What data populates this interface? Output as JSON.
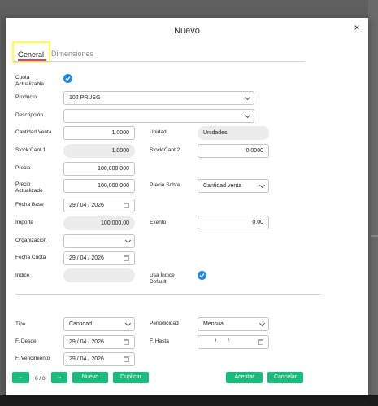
{
  "dialog": {
    "title": "Nuevo",
    "close_icon": "×"
  },
  "tabs": [
    {
      "label": "General",
      "active": true
    },
    {
      "label": "Dimensiones",
      "active": false
    }
  ],
  "form": {
    "cuota_actualizable": {
      "label": "Cuota Actualizable",
      "checked": true
    },
    "producto": {
      "label": "Producto",
      "value": "102 PRUSG"
    },
    "descripcion": {
      "label": "Descripción",
      "value": ""
    },
    "cantidad_venta": {
      "label": "Cantidad Venta",
      "value": "1.0000"
    },
    "unidad": {
      "label": "Unidad",
      "value": "Unidades"
    },
    "stock_cant1": {
      "label": "Stock:Cant.1",
      "value": "1.0000"
    },
    "stock_cant2": {
      "label": "Stock:Cant.2",
      "value": "0.0000"
    },
    "precio": {
      "label": "Precio",
      "value": "100,000.000"
    },
    "precio_actualizado": {
      "label": "Precio Actualizado",
      "value": "100,000.000"
    },
    "precio_sobre": {
      "label": "Precio Sobre",
      "value": "Cantidad venta"
    },
    "fecha_base": {
      "label": "Fecha Base",
      "day": "29",
      "month": "04",
      "year": "2026"
    },
    "importe": {
      "label": "Importe",
      "value": "100,000.00"
    },
    "exento": {
      "label": "Exento",
      "value": "0.00"
    },
    "organizacion": {
      "label": "Organizacion",
      "value": ""
    },
    "fecha_cuota": {
      "label": "Fecha Cuota",
      "day": "29",
      "month": "04",
      "year": "2026"
    },
    "indice": {
      "label": "Indice",
      "value": ""
    },
    "usa_indice_default": {
      "label": "Usa Índice Default",
      "checked": true
    },
    "tipo": {
      "label": "Tipo",
      "value": "Cantidad"
    },
    "periodicidad": {
      "label": "Periodicidad",
      "value": "Mensual"
    },
    "f_desde": {
      "label": "F. Desde",
      "day": "29",
      "month": "04",
      "year": "2026"
    },
    "f_hasta": {
      "label": "F. Hasta",
      "day": "",
      "month": "",
      "year": ""
    },
    "f_vencimiento": {
      "label": "F. Vencimiento",
      "day": "29",
      "month": "04",
      "year": "2026"
    },
    "date_sep": "/"
  },
  "footer": {
    "prev_icon": "←",
    "counter": "0 / 0",
    "next_icon": "→",
    "nuevo": "Nuevo",
    "duplicar": "Duplicar",
    "aceptar": "Aceptar",
    "cancelar": "Cancelar"
  },
  "colors": {
    "accent": "#1abc7c",
    "check": "#1e88e5",
    "tab_underline": "#e5414e",
    "highlight": "#ffff3a"
  }
}
